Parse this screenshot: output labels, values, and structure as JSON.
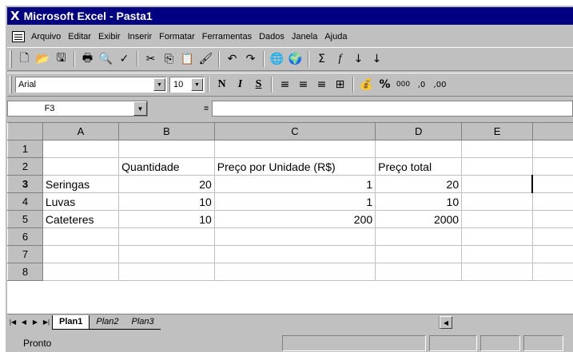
{
  "window": {
    "title": "Microsoft Excel - Pasta1"
  },
  "menu": [
    "Arquivo",
    "Editar",
    "Exibir",
    "Inserir",
    "Formatar",
    "Ferramentas",
    "Dados",
    "Janela",
    "Ajuda"
  ],
  "toolbar_std": {
    "icons": [
      "new-icon",
      "open-icon",
      "save-icon",
      "print-icon",
      "preview-icon",
      "spelling-icon",
      "cut-icon",
      "copy-icon",
      "paste-icon",
      "format-painter-icon",
      "undo-icon",
      "redo-icon",
      "hyperlink-icon",
      "web-toolbar-icon",
      "autosum-icon",
      "function-icon",
      "sort-asc-icon",
      "sort-desc-icon"
    ],
    "glyphs": [
      "🗋",
      "📂",
      "🖫",
      "🖶",
      "🔍",
      "✓",
      "✂",
      "⎘",
      "📋",
      "🖌",
      "↶",
      "↷",
      "🌐",
      "🌍",
      "Σ",
      "f",
      "↓",
      "↓"
    ]
  },
  "toolbar_fmt": {
    "font": "Arial",
    "size": "10",
    "bold": "N",
    "italic": "I",
    "underline": "S",
    "percent": "%",
    "thousands": "000",
    "dec_inc": ",0",
    "dec_dec": ",00"
  },
  "formula_bar": {
    "cell": "F3",
    "equals": "=",
    "value": ""
  },
  "grid": {
    "columns": [
      "A",
      "B",
      "C",
      "D",
      "E"
    ],
    "rows": [
      {
        "n": "1",
        "cells": [
          "",
          "",
          "",
          "",
          ""
        ]
      },
      {
        "n": "2",
        "cells": [
          "",
          "Quantidade",
          "Preço por Unidade (R$)",
          "Preço total",
          ""
        ]
      },
      {
        "n": "3",
        "cells": [
          "Seringas",
          "20",
          "1",
          "20",
          ""
        ]
      },
      {
        "n": "4",
        "cells": [
          "Luvas",
          "10",
          "1",
          "10",
          ""
        ]
      },
      {
        "n": "5",
        "cells": [
          "Cateteres",
          "10",
          "200",
          "2000",
          ""
        ]
      },
      {
        "n": "6",
        "cells": [
          "",
          "",
          "",
          "",
          ""
        ]
      },
      {
        "n": "7",
        "cells": [
          "",
          "",
          "",
          "",
          ""
        ]
      },
      {
        "n": "8",
        "cells": [
          "",
          "",
          "",
          "",
          ""
        ]
      }
    ]
  },
  "sheets": [
    "Plan1",
    "Plan2",
    "Plan3"
  ],
  "active_sheet": "Plan1",
  "status": "Pronto"
}
